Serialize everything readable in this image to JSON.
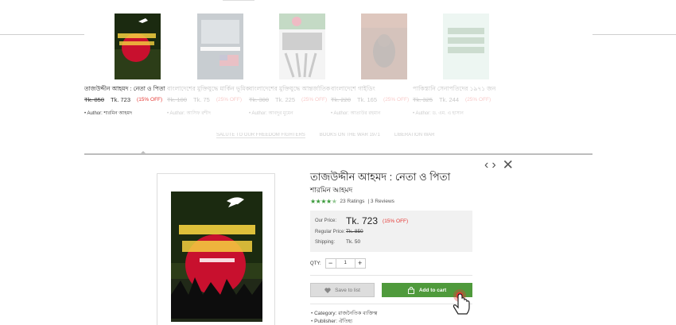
{
  "carousel": {
    "books": [
      {
        "title": "তাজউদ্দীন আহমদ : নেতা ও পিতা",
        "old_price": "Tk. 850",
        "new_price": "Tk. 723",
        "discount": "(15% OFF)",
        "author_label": "Author:",
        "author": "শারমিন আহমদ"
      },
      {
        "title": "বাংলাদেশের মুক্তিযুদ্ধে মার্কিন ভূমিকার গোপন দলিল",
        "old_price": "Tk. 100",
        "new_price": "Tk. 75",
        "discount": "(25% OFF)",
        "author_label": "Author:",
        "author": "আসিফ রশীদ"
      },
      {
        "title": "বাংলাদেশের মুক্তিযুদ্ধে আন্তর্জাতিক ও ভারত",
        "old_price": "Tk. 300",
        "new_price": "Tk. 225",
        "discount": "(25% OFF)",
        "author_label": "Author:",
        "author": "আবদুর মুমেন"
      },
      {
        "title": "বাংলাদেশে গাইডিং",
        "old_price": "Tk. 220",
        "new_price": "Tk. 165",
        "discount": "(25% OFF)",
        "author_label": "Author:",
        "author": "আতাউর রহমান"
      },
      {
        "title": "পাকিস্তানি সেনাপতিদের ১৯৭১ জন",
        "old_price": "Tk. 325",
        "new_price": "Tk. 244",
        "discount": "(25% OFF)",
        "author_label": "Author:",
        "author": "ড. এম. এ হাসান"
      }
    ],
    "tabs": [
      "SALUTE TO OUR FREEDOM FIGHTERS",
      "BOOKS ON THE WAR 1971",
      "LIBERATION WAR"
    ]
  },
  "quickview": {
    "title": "তাজউদ্দীন আহমদ : নেতা ও পিতা",
    "author": "শারমিন আহমদ",
    "ratings": "23 Ratings",
    "reviews": "| 3 Reviews",
    "rating_value": 4.5,
    "our_price_label": "Our Price:",
    "our_price": "Tk. 723",
    "discount": "(15% OFF)",
    "regular_price_label": "Regular Price:",
    "regular_price": "Tk. 850",
    "shipping_label": "Shipping:",
    "shipping": "Tk. 50",
    "qty_label": "QTY:",
    "qty_minus": "−",
    "qty_value": "1",
    "qty_plus": "+",
    "save_label": "Save to list",
    "cart_label": "Add to cart",
    "category_label": "Category:",
    "category": "রাজনৈতিক ব্যক্তিত্ব",
    "publisher_label": "Publisher:",
    "publisher": "ঐতিহ্য",
    "nav_prev": "‹",
    "nav_next": "›",
    "close": "✕"
  },
  "colors": {
    "accent_green": "#4f9a3c",
    "discount_red": "#e53935",
    "star_green": "#3b9a3b"
  }
}
